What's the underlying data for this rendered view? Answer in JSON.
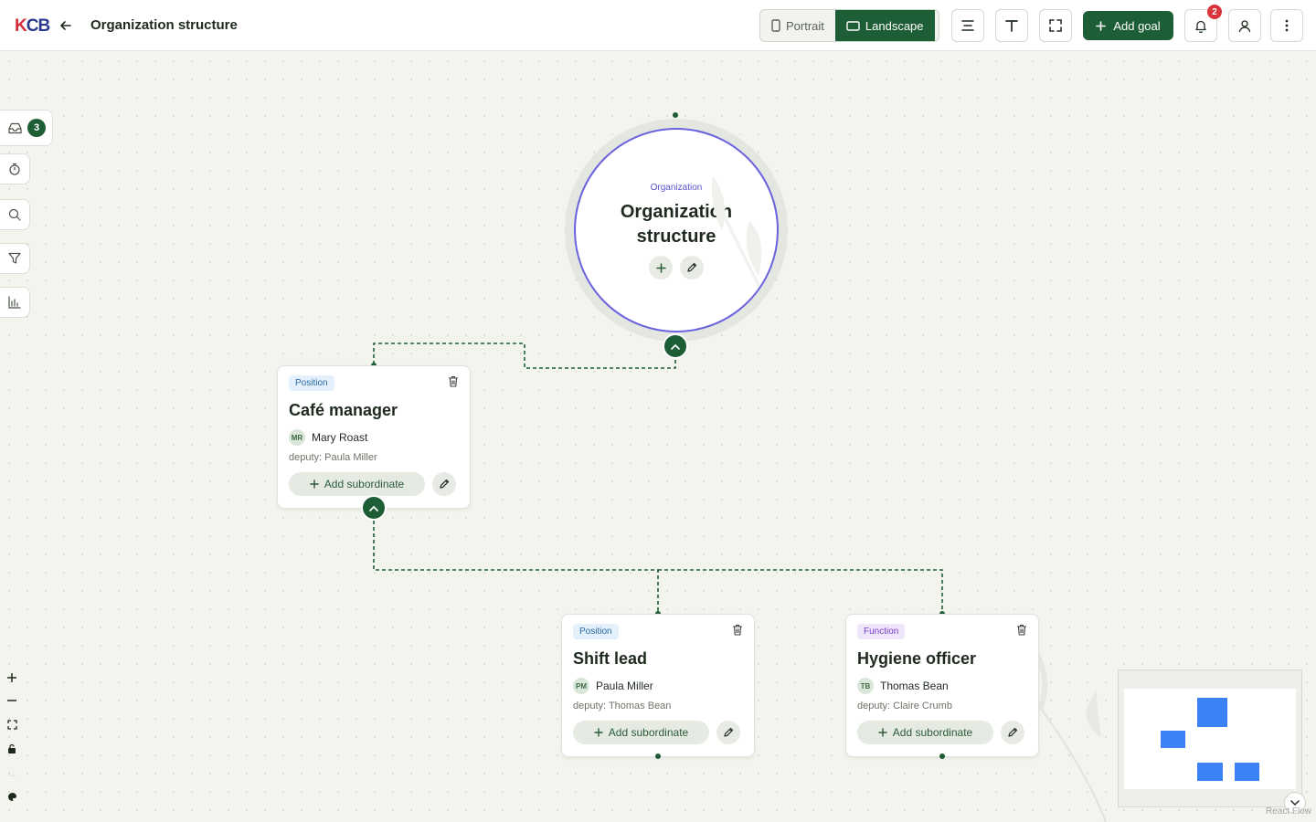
{
  "header": {
    "logo": "KCB",
    "title": "Organization structure",
    "orientation": {
      "portrait_label": "Portrait",
      "landscape_label": "Landscape",
      "selected": "Landscape"
    },
    "add_goal_label": "Add goal",
    "notification_count": "2",
    "icons": [
      "back-arrow-icon",
      "align-center-icon",
      "text-icon",
      "fullscreen-icon",
      "bell-icon",
      "user-icon",
      "more-vertical-icon"
    ]
  },
  "sidebar": {
    "inbox_count": "3",
    "items": [
      "inbox-icon",
      "timer-icon",
      "search-icon",
      "filter-icon",
      "bar-chart-icon"
    ]
  },
  "organization": {
    "label": "Organization",
    "title_line1": "Organization",
    "title_line2": "structure"
  },
  "nodes": [
    {
      "tag": "Position",
      "title": "Café manager",
      "initials": "MR",
      "person": "Mary Roast",
      "deputy": "deputy: Paula Miller",
      "add_label": "Add subordinate"
    },
    {
      "tag": "Position",
      "title": "Shift lead",
      "initials": "PM",
      "person": "Paula Miller",
      "deputy": "deputy: Thomas Bean",
      "add_label": "Add subordinate"
    },
    {
      "tag": "Function",
      "title": "Hygiene officer",
      "initials": "TB",
      "person": "Thomas Bean",
      "deputy": "deputy: Claire Crumb",
      "add_label": "Add subordinate"
    }
  ],
  "zoom_controls": [
    "plus-icon",
    "minus-icon",
    "fit-view-icon",
    "lock-icon",
    "moon-icon",
    "palette-icon"
  ],
  "attribution": "React Flow",
  "colors": {
    "accent": "#1e5e36",
    "org_border": "#6a63e0",
    "minimap_node": "#3b82f6",
    "badge_red": "#d9343a"
  }
}
